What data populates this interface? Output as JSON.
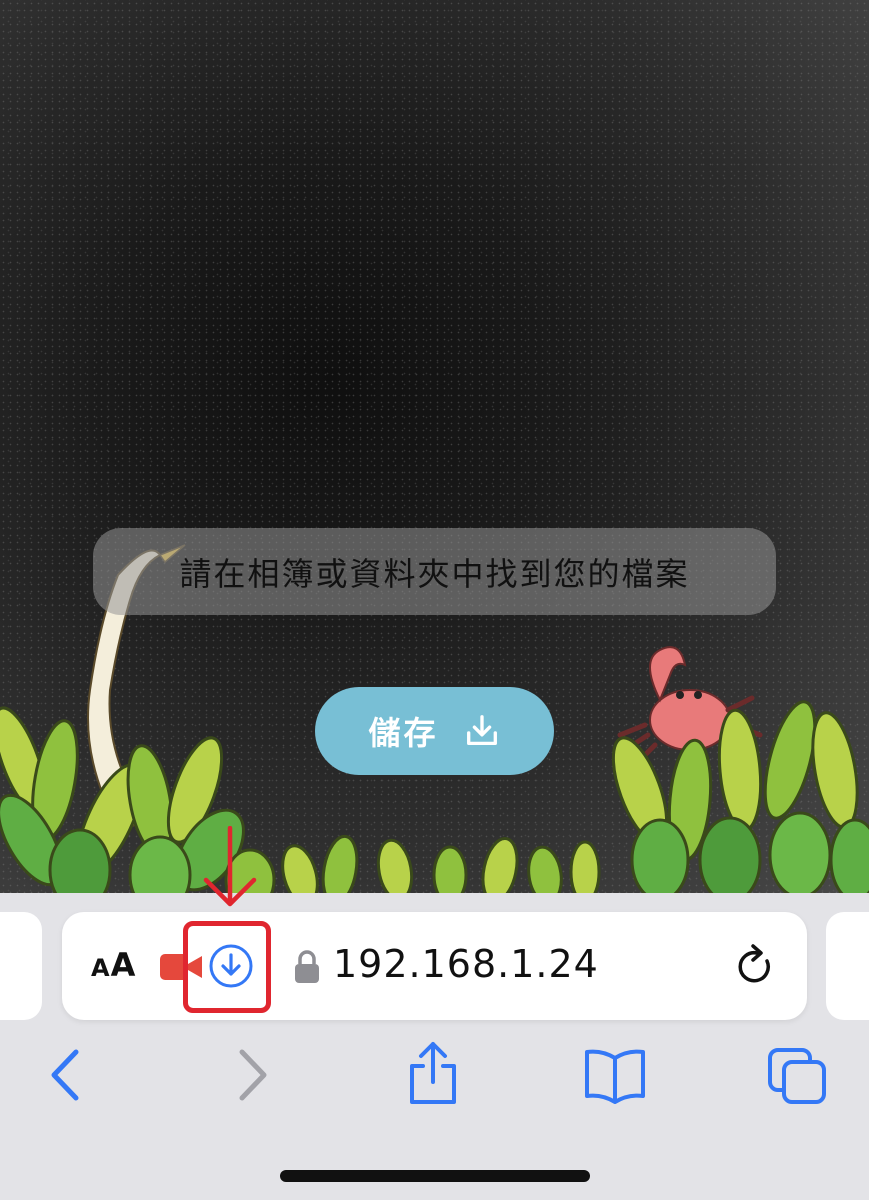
{
  "page": {
    "toast_text": "請在相簿或資料夾中找到您的檔案",
    "save_button_label": "儲存"
  },
  "address_bar": {
    "text_size_label_small": "A",
    "text_size_label_large": "A",
    "url": "192.168.1.24"
  },
  "colors": {
    "accent": "#3478f6",
    "save_button": "#78bfd5",
    "highlight": "#e0262f",
    "toolbar_background": "#e3e3e7"
  },
  "icons": [
    "video-camera-icon",
    "download-icon",
    "lock-icon",
    "reload-icon",
    "back-icon",
    "forward-icon",
    "share-icon",
    "bookmarks-icon",
    "tabs-icon"
  ]
}
